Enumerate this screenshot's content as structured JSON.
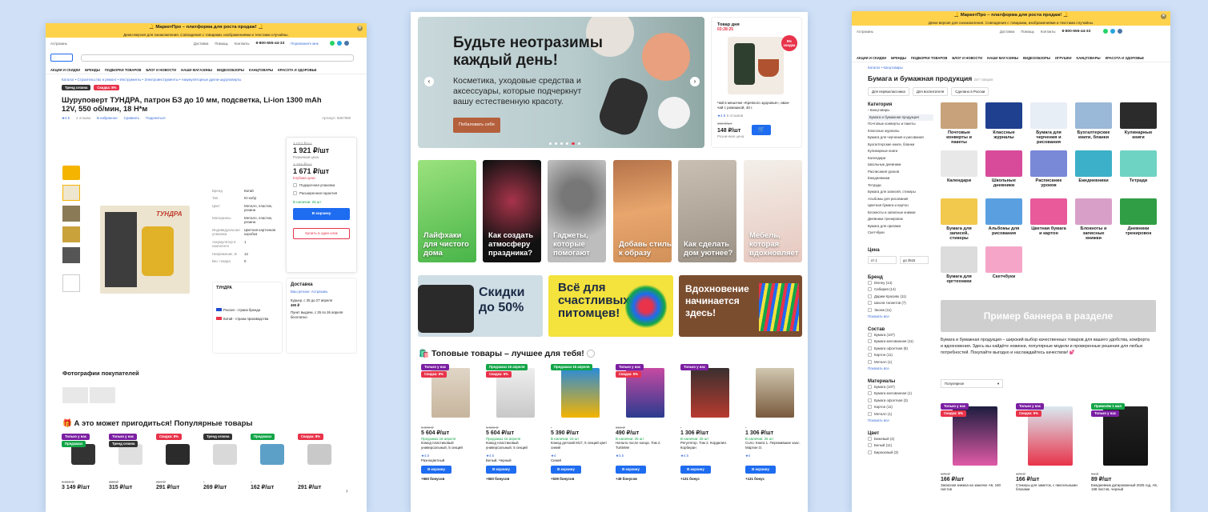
{
  "topbar": {
    "title": "🔔 МаркетПро – платформа для роста продаж! 🔔",
    "subtitle": "Демо-версия для ознакомления. Совпадения с товарами, изображениями и текстами случайны."
  },
  "header": {
    "city": "Астрахань",
    "links": [
      "Доставка",
      "Помощь",
      "Контакты"
    ],
    "phone": "8-800-555-44-33",
    "callback": "Перезвоните мне"
  },
  "nav": [
    "АКЦИИ И СКИДКИ",
    "БРЕНДЫ",
    "ПОДБОРКИ ТОВАРОВ",
    "БЛОГ И НОВОСТИ",
    "НАШИ МАГАЗИНЫ",
    "ВИДЕООБЗОРЫ",
    "ИГРУШКИ",
    "КАНЦТОВАРЫ",
    "КРАСОТА И ЗДОРОВЬЕ"
  ],
  "product_page": {
    "breadcrumb": "Каталог  •  Строительство и ремонт  •  Инструменты  •  Электроинструменты  •  Аккумуляторные дрели-шуруповерты",
    "tags": [
      "Тренд сезона",
      "Скидка: 8%"
    ],
    "title": "Шуруповерт ТУНДРА, патрон БЗ до 10 мм, подсветка, Li-ion 1300 mAh 12V, 550 об/мин, 18 Н*м",
    "rating": "★4.5",
    "reviews": "2 отзыва",
    "actions": [
      "В избранное",
      "Сравнить",
      "Поделиться"
    ],
    "article": "Артикул: 5857898",
    "specs": [
      [
        "Бренд",
        "Катай"
      ],
      [
        "Тип",
        "Ю-кобр"
      ],
      [
        "Цвет",
        "Металл, пластик, резина"
      ],
      [
        "Материалы",
        "Металл, пластик, резина"
      ],
      [
        "Индивидуальная упаковка",
        "Цветная картонная коробка"
      ],
      [
        "Аккумулятор в комплекте",
        "1"
      ],
      [
        "Напряжение, В",
        "12"
      ],
      [
        "Вес товара",
        "0"
      ]
    ],
    "box": {
      "old_price1": "2 072 ₽/шт",
      "price1": "1 921 ₽/шт",
      "label1": "Розничная цена",
      "old_price2": "1 759 ₽/шт",
      "price2": "1 671 ₽/шт",
      "label2": "Клубная цена",
      "opt1": "Подарочная упаковка",
      "opt2": "Расширенная гарантия",
      "stock": "В наличии: 25 шт",
      "cart": "В корзину",
      "buy": "Купить в один клик"
    },
    "brand": {
      "name": "ТУНДРА",
      "country1": "Россия - страна бренда",
      "country2": "Китай - страна производства"
    },
    "delivery": {
      "title": "Доставка",
      "region": "Ваш регион: Астрахань",
      "line1": "Курьер, с 25 до 27 апреля",
      "price1": "490 ₽",
      "line2": "Пункт выдачи, с 25 по 26 апреля",
      "price2": "бесплатно"
    },
    "photos_title": "Фотографии покупателей",
    "pop_title": "🎁 А это может пригодиться! Популярные товары",
    "pop": [
      {
        "tag": "Только у нас",
        "tag2": "Предзаказ",
        "old": "3 312 ₽",
        "price": "3 149 ₽/шт"
      },
      {
        "tag": "Только у нас",
        "tag2": "Тренд сезона",
        "old": "339 ₽",
        "price": "315 ₽/шт"
      },
      {
        "tag": "Скидка: 8%",
        "tag2": "",
        "old": "317 ₽",
        "price": "291 ₽/шт"
      },
      {
        "tag": "Тренд сезона",
        "tag2": "",
        "old": "",
        "price": "269 ₽/шт"
      },
      {
        "tag": "Предзаказ",
        "tag2": "",
        "old": "",
        "price": "162 ₽/шт"
      },
      {
        "tag": "Скидка: 8%",
        "tag2": "",
        "old": "",
        "price": "291 ₽/шт"
      }
    ]
  },
  "home": {
    "hero": {
      "title": "Будьте неотразимы каждый день!",
      "text": "Косметика, уходовые средства и аксессуары, которые подчеркнут вашу естественную красоту.",
      "button": "Побаловать себя"
    },
    "deal": {
      "label": "Товар дня",
      "timer": "03:28:25",
      "badge": "5% скидка",
      "name": "Чай в мешочке «Крепкого здоровья», иван-чай с ромашкой, 40 г.",
      "rating": "★4.8",
      "reviews": "5 отзывов",
      "old": "156 ₽/шт",
      "price": "148 ₽/шт",
      "retail": "Розничная цена"
    },
    "tiles": [
      "Лайфхаки для чистого дома",
      "Как создать атмосферу праздника?",
      "Гаджеты, которые помогают",
      "Добавь стиль к образу",
      "Как сделать дом уютнее?",
      "Мебель, которая вдохновляет"
    ],
    "banners": [
      "Скидки до 50%",
      "Всё для счастливых питомцев!",
      "Вдохновение начинается здесь!"
    ],
    "top_title": "🛍️ Топовые товары – лучшее для тебя!",
    "products": [
      {
        "tag": "Только у нас",
        "tag2": "Скидка: 5%",
        "old": "5 899 ₽",
        "price": "5 604 ₽/шт",
        "avail": "Предзаказ 16 апреля",
        "name": "Комод пластиковый универсальный, 5 секций",
        "rating": "★4.5",
        "color": "Разноцветный",
        "bonus": "+560 бонусов"
      },
      {
        "tag": "Предзаказ 16 апреля",
        "tag2": "Скидка: 5%",
        "old": "5 899 ₽",
        "price": "5 604 ₽/шт",
        "avail": "Предзаказ 16 апреля",
        "name": "Комод пластиковый универсальный, 5 секций",
        "rating": "★4.5",
        "color": "Белый, Черный",
        "bonus": "+560 бонусов"
      },
      {
        "tag": "Предзаказ 16 апреля",
        "tag2": "",
        "old": "",
        "price": "5 390 ₽/шт",
        "avail": "В наличии: 15 шт",
        "name": "Комод детский М17, 5 секций цвет синий",
        "rating": "★4",
        "color": "Синий",
        "bonus": "+539 бонусов"
      },
      {
        "tag": "Только у нас",
        "tag2": "Скидка: 5%",
        "old": "516 ₽",
        "price": "490 ₽/шт",
        "avail": "В наличии: 25 шт",
        "name": "Начало после конца. Том 2. TurtleMe",
        "rating": "★3.5",
        "color": "",
        "bonus": "+49 бонусов"
      },
      {
        "tag": "Только у нас",
        "tag2": "",
        "old": "",
        "price": "1 306 ₽/шт",
        "avail": "В наличии: 25 шт",
        "name": "Регулятор. Том 2. Кордилия. Корберан",
        "rating": "★4.5",
        "color": "",
        "bonus": "+131 бонус"
      },
      {
        "tag": "",
        "tag2": "",
        "old": "",
        "price": "1 306 ₽/шт",
        "avail": "В наличии: 25 шт",
        "name": "Соло. Книга 1. Пережившие хаос. Мартин О.",
        "rating": "★4",
        "color": "",
        "bonus": "+131 бонус"
      }
    ],
    "cart": "В корзину"
  },
  "catalog": {
    "breadcrumb": "Каталог  •  Канцтовары",
    "title": "Бумага и бумажная продукция",
    "count": "247 товаров",
    "chips": [
      "Для первоклассника",
      "Для воспитателя",
      "Сделано в России"
    ],
    "side_title": "Категория",
    "side_back": "‹ Канцтовары",
    "side_active": "Бумага и бумажная продукция",
    "side_items": [
      "Почтовые конверты и пакеты",
      "Классные журналы",
      "Бумага для черчения и рисования",
      "Бухгалтерские книги, бланки",
      "Кулинарные книги",
      "Календари",
      "Школьные дневники",
      "Расписания уроков",
      "Ежедневники",
      "Тетради",
      "Бумага для записей, стикеры",
      "Альбомы для рисования",
      "Цветная бумага и картон",
      "Блокноты и записные книжки",
      "Дневники тренировок",
      "Бумага для оригами",
      "Скетчбуки"
    ],
    "price_title": "Цена",
    "price_from": "от 1",
    "price_to": "до 3515",
    "brand_title": "Бренд",
    "brands": [
      "Disney (14)",
      "Сибирия (14)",
      "Дарим Красиво (11)",
      "Школа талантов (7)",
      "Экоеж (11)"
    ],
    "show_all": "Показать все",
    "sostav_title": "Состав",
    "sostav": [
      "Бумага (107)",
      "Бумага мелованная (11)",
      "Бумага офсетная (9)",
      "Картон (11)",
      "Металл (1)"
    ],
    "mat_title": "Материалы",
    "mats": [
      "Бумага (107)",
      "Бумага мелованная (1)",
      "Бумага офсетная (3)",
      "Картон (11)",
      "Металл (1)"
    ],
    "color_title": "Цвет",
    "colors": [
      "Бежевый (4)",
      "Белый (11)",
      "Бирюзовый (3)"
    ],
    "cats": [
      "Почтовые конверты и пакеты",
      "Классные журналы",
      "Бумага для черчения и рисования",
      "Бухгалтерские книги, бланки",
      "Кулинарные книги",
      "Календари",
      "Школьные дневники",
      "Расписание уроков",
      "Ежедневники",
      "Тетради",
      "Бумага для записей, стикеры",
      "Альбомы для рисования",
      "Цветная бумага и картон",
      "Блокноты и записные книжки",
      "Дневники тренировок",
      "Бумага для оргтехники",
      "Скетчбуки"
    ],
    "banner": "Пример баннера в разделе",
    "desc": "Бумага и бумажная продукция – широкий выбор качественных товаров для вашего удобства, комфорта и вдохновения. Здесь вы найдёте новинки, популярные модели и проверенные решения для любых потребностей. Покупайте выгодно и наслаждайтесь качеством! 💕",
    "sort": "Популярное",
    "products": [
      {
        "tag": "Только у нас",
        "tag2": "Скидка: 5%",
        "old": "175 ₽",
        "price": "166 ₽/шт",
        "name": "Записная книжка на замочке А6, 160 листов"
      },
      {
        "tag": "Только у нас",
        "tag2": "Скидка: 5%",
        "old": "175 ₽",
        "price": "166 ₽/шт",
        "name": "Стикеры для заметок, с пиксельными блоками"
      },
      {
        "tag": "Привезём 1 мая",
        "tag2": "Только у нас",
        "old": "94 ₽",
        "price": "89 ₽/шт",
        "name": "Ежедневник датированный 2025 год, А5, 168 листов, черный"
      }
    ]
  },
  "colors": {
    "yellow": "#ffd24c",
    "blue": "#1e6cf0",
    "green": "#13a548",
    "red": "#e8334a",
    "purple": "#7b1fa2"
  }
}
